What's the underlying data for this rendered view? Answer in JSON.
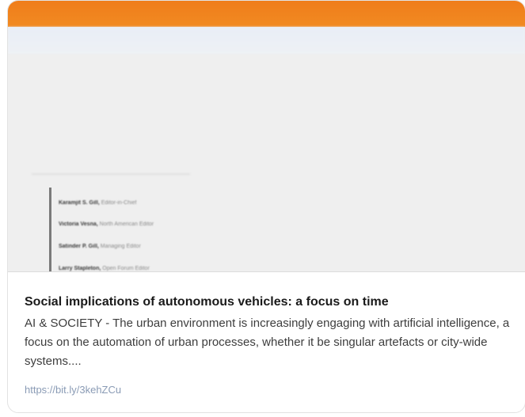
{
  "preview": {
    "accent_color": "#f07d1a",
    "editors": [
      {
        "name": "Karamjit S. Gill,",
        "role": "Editor-in-Chief"
      },
      {
        "name": "Victoria Vesna,",
        "role": "North American Editor"
      },
      {
        "name": "Satinder P. Gill,",
        "role": "Managing Editor"
      },
      {
        "name": "Larry Stapleton,",
        "role": "Open Forum Editor"
      }
    ]
  },
  "card": {
    "title": "Social implications of autonomous vehicles: a focus on time",
    "description": "AI & SOCIETY - The urban environment is increasingly engaging with artificial intelligence, a focus on the automation of urban processes, whether it be singular artefacts or city-wide systems....",
    "link": "https://bit.ly/3kehZCu"
  }
}
